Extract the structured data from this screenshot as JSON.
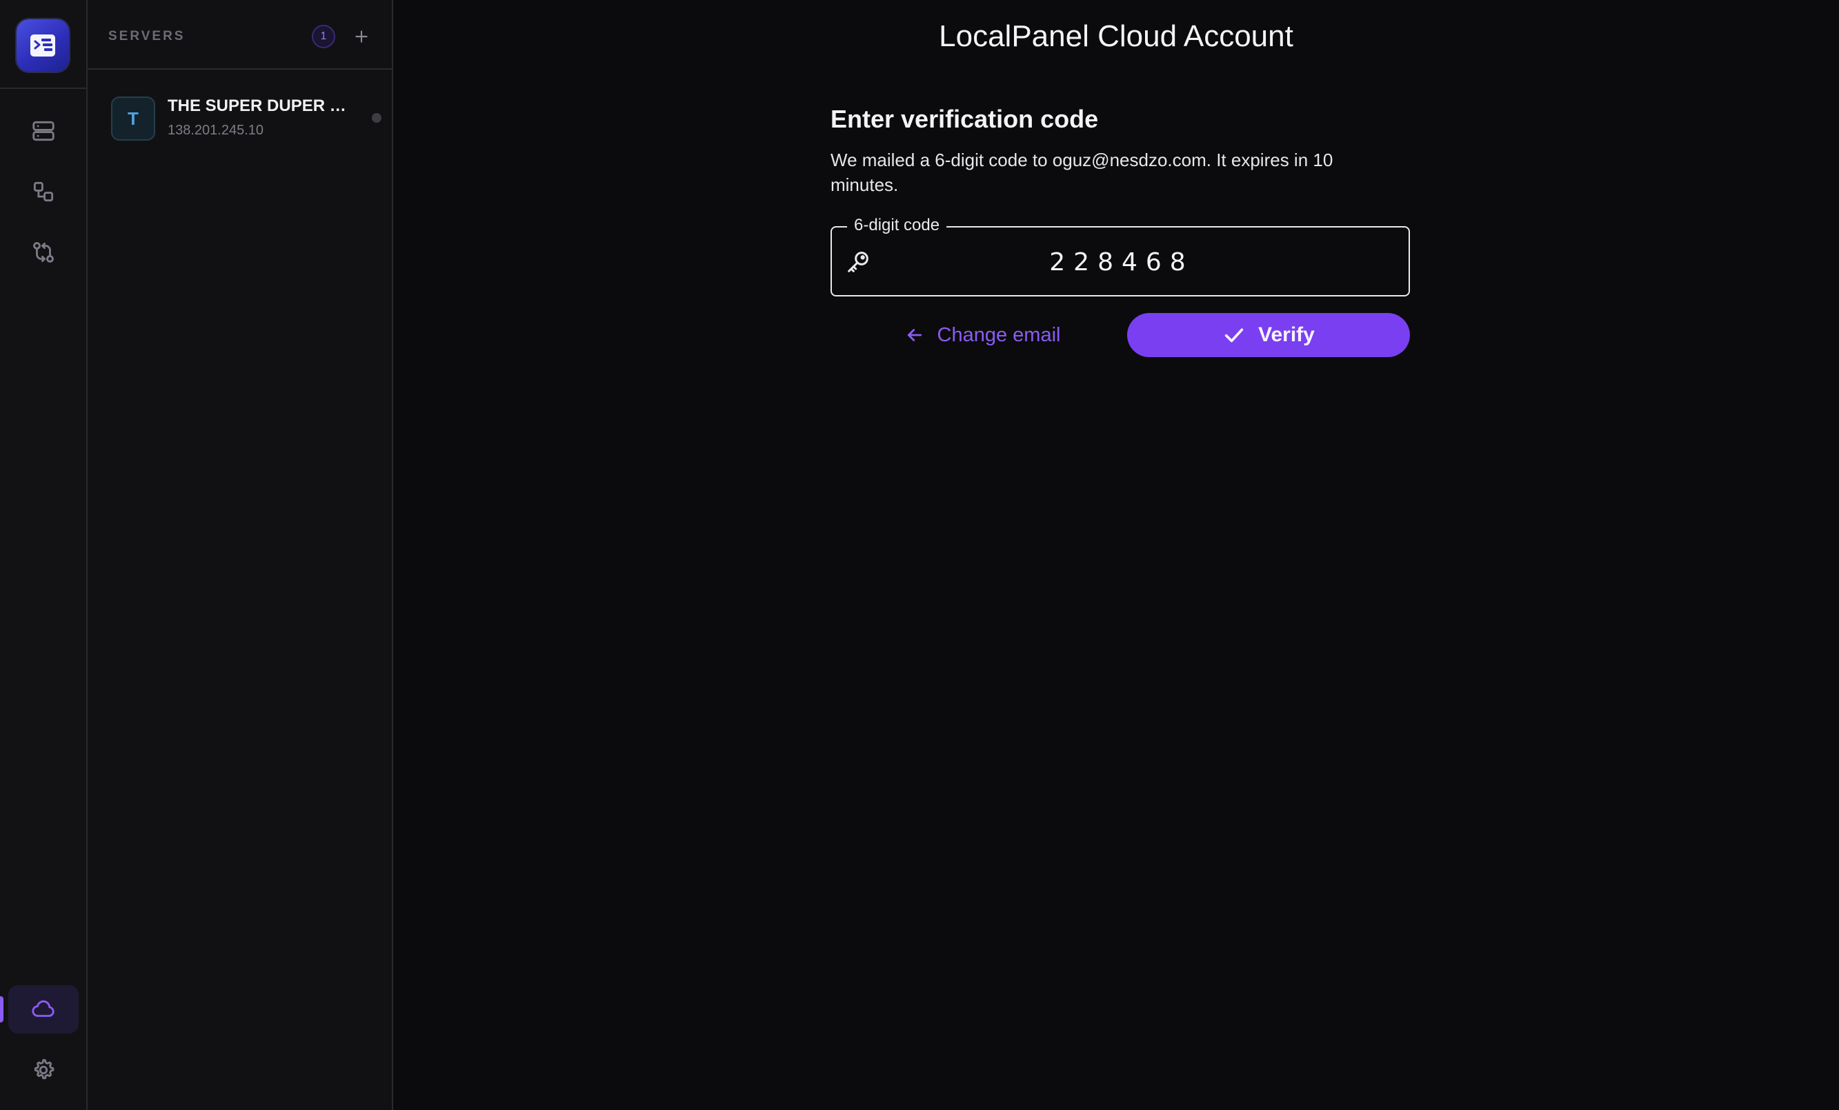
{
  "rail": {
    "logo_icon": "app-logo-terminal-icon",
    "items": [
      {
        "name": "servers",
        "icon": "server-stack-icon"
      },
      {
        "name": "connections",
        "icon": "nodes-icon"
      },
      {
        "name": "sync",
        "icon": "transfer-icon"
      }
    ],
    "bottom": [
      {
        "name": "cloud",
        "icon": "cloud-icon",
        "active": true
      },
      {
        "name": "settings",
        "icon": "gear-icon"
      }
    ]
  },
  "servers": {
    "title": "SERVERS",
    "count": "1",
    "add_icon": "plus-icon",
    "list": [
      {
        "avatar": "T",
        "name": "THE SUPER DUPER S...",
        "ip": "138.201.245.10",
        "status": "offline"
      }
    ]
  },
  "main": {
    "title": "LocalPanel Cloud Account",
    "heading": "Enter verification code",
    "description": "We mailed a 6-digit code to oguz@nesdzo.com. It expires in 10 minutes.",
    "code_field": {
      "label": "6-digit code",
      "value": "228468",
      "icon": "key-icon"
    },
    "change_email_label": "Change email",
    "verify_label": "Verify"
  },
  "colors": {
    "background": "#0b0b0d",
    "panel": "#111113",
    "accent": "#8b5cf6",
    "verify_button": "#7a3ff0",
    "server_avatar_text": "#4fa3e0"
  }
}
